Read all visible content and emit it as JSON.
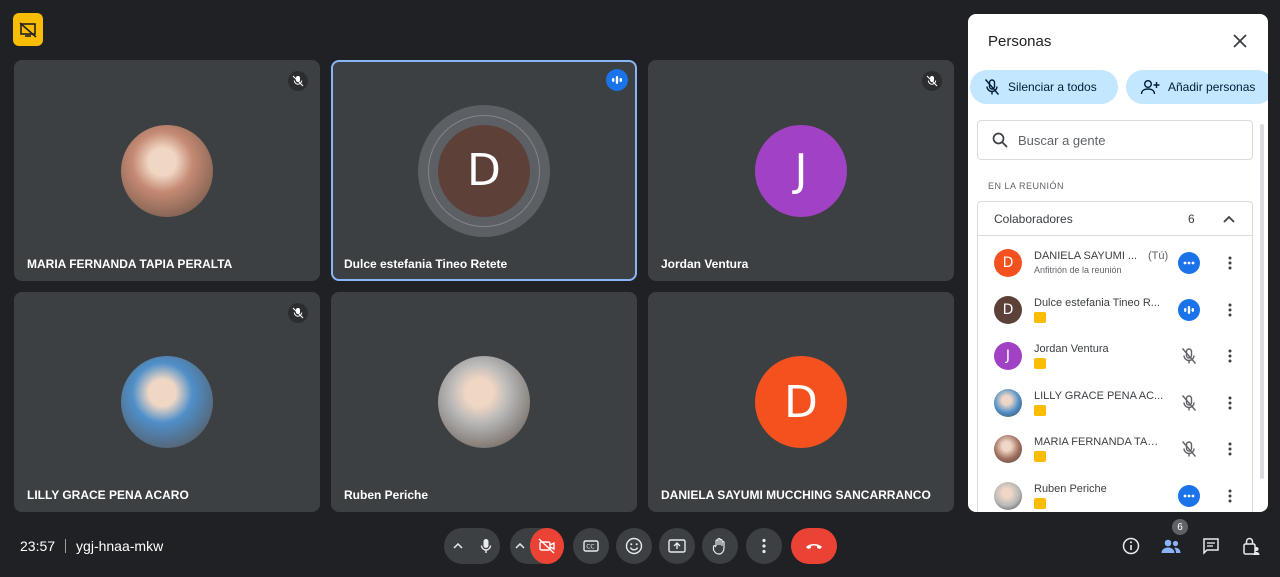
{
  "tiles": [
    {
      "name": "MARIA FERNANDA TAPIA PERALTA",
      "avatar": "photo",
      "photo_color": "#c58a74",
      "muted": true,
      "speaking": false,
      "active": false
    },
    {
      "name": "Dulce estefania Tineo Retete",
      "avatar": "D",
      "avatar_color": "#5d4037",
      "muted": false,
      "speaking": true,
      "active": true
    },
    {
      "name": "Jordan Ventura",
      "avatar": "J",
      "avatar_color": "#a142c4",
      "muted": true,
      "speaking": false,
      "active": false
    },
    {
      "name": "LILLY GRACE PENA ACARO",
      "avatar": "photo",
      "photo_color": "#4f8fc9",
      "muted": true,
      "speaking": false,
      "active": false
    },
    {
      "name": "Ruben Periche",
      "avatar": "photo",
      "photo_color": "#b8b8b8",
      "muted": false,
      "speaking": false,
      "active": false
    },
    {
      "name": "DANIELA SAYUMI MUCCHING SANCARRANCO",
      "avatar": "D",
      "avatar_color": "#f4511e",
      "muted": false,
      "speaking": false,
      "active": false
    }
  ],
  "bottom": {
    "time": "23:57",
    "meeting_code": "ygj-hnaa-mkw",
    "people_count": "6"
  },
  "panel": {
    "title": "Personas",
    "mute_all": "Silenciar a todos",
    "add_people": "Añadir personas",
    "search_placeholder": "Buscar a gente",
    "section": "EN LA REUNIÓN",
    "group_label": "Colaboradores",
    "group_count": "6",
    "participants": [
      {
        "name": "DANIELA SAYUMI ...",
        "you": "(Tú)",
        "sub": "Anfitrión de la reunión",
        "initial": "D",
        "color": "#f4511e",
        "status": "dots"
      },
      {
        "name": "Dulce estefania Tineo R...",
        "initial": "D",
        "color": "#5d4037",
        "status": "speaking"
      },
      {
        "name": "Jordan Ventura",
        "initial": "J",
        "color": "#a142c4",
        "status": "muted"
      },
      {
        "name": "LILLY GRACE PENA AC...",
        "initial": "",
        "color": "#4f8fc9",
        "status": "muted"
      },
      {
        "name": "MARIA FERNANDA TAPI...",
        "initial": "",
        "color": "#a1705f",
        "status": "muted"
      },
      {
        "name": "Ruben Periche",
        "initial": "",
        "color": "#b8b8b8",
        "status": "dots"
      }
    ]
  }
}
